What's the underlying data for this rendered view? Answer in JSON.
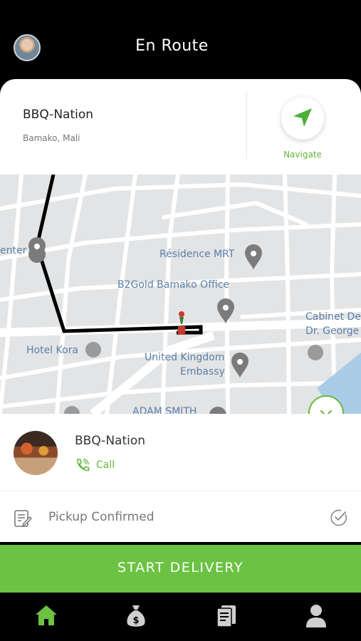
{
  "header": {
    "title": "En Route"
  },
  "destination": {
    "name": "BBQ-Nation",
    "address": "Bamako, Mali",
    "navigate_label": "Navigate"
  },
  "map": {
    "places": [
      "enter",
      "Résidence MRT",
      "B2Gold Bamako Office",
      "Cabinet De",
      "Dr. George",
      "Hotel Kora",
      "United Kingdom",
      "Embassy",
      "ADAM SMITH"
    ]
  },
  "restaurant": {
    "name": "BBQ-Nation",
    "call_label": "Call"
  },
  "pickup": {
    "label": "Pickup Confirmed"
  },
  "action": {
    "start_label": "START DELIVERY"
  },
  "tabs": [
    "home-icon",
    "money-bag-icon",
    "orders-icon",
    "profile-icon"
  ],
  "colors": {
    "accent": "#6cc242",
    "header_bg": "#000000"
  }
}
